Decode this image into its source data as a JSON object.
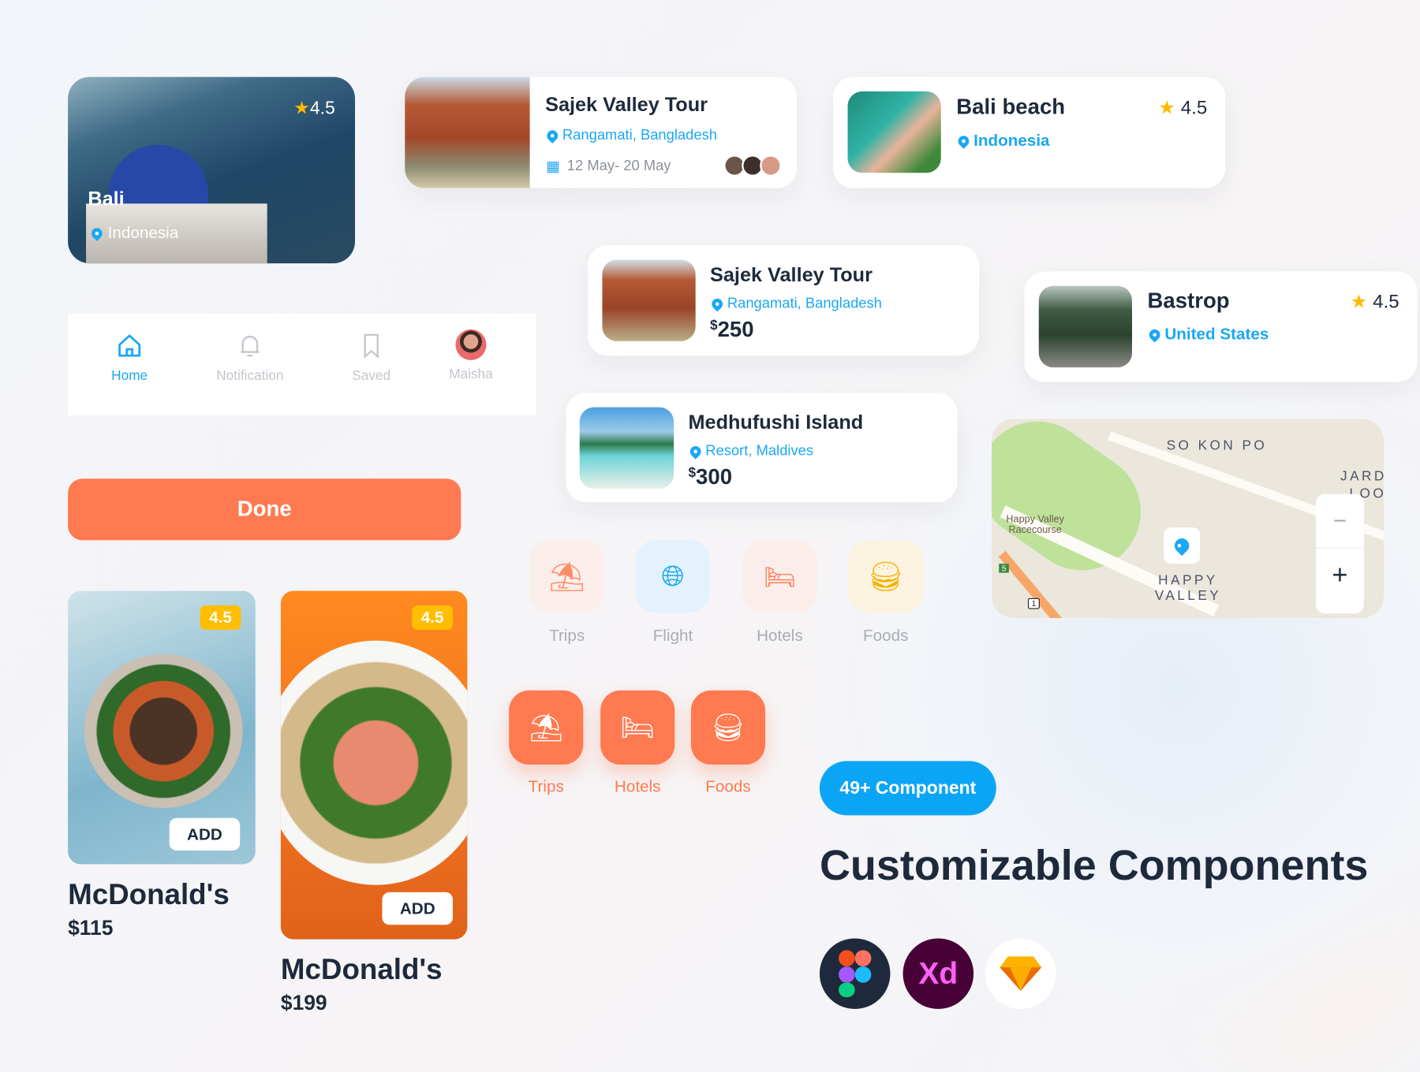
{
  "colors": {
    "accent_orange": "#FF7A50",
    "accent_blue": "#1AA7F4",
    "star": "#FFB800",
    "badge": "#FFBE00",
    "text": "#1E2A3B"
  },
  "bali_card": {
    "title": "Bali",
    "location": "Indonesia",
    "rating": "4.5"
  },
  "sajek_tour": {
    "title": "Sajek Valley Tour",
    "location": "Rangamati, Bangladesh",
    "dates": "12 May- 20 May"
  },
  "bali_beach": {
    "title": "Bali beach",
    "location": "Indonesia",
    "rating": "4.5"
  },
  "nav": {
    "items": [
      {
        "label": "Home",
        "icon": "home-icon",
        "active": true
      },
      {
        "label": "Notification",
        "icon": "bell-icon"
      },
      {
        "label": "Saved",
        "icon": "bookmark-icon"
      },
      {
        "label": "Maisha",
        "icon": "avatar"
      }
    ]
  },
  "sajek_price": {
    "title": "Sajek Valley Tour",
    "location": "Rangamati, Bangladesh",
    "currency": "$",
    "price": "250"
  },
  "bastrop": {
    "title": "Bastrop",
    "location": "United States",
    "rating": "4.5"
  },
  "medhufushi": {
    "title": "Medhufushi Island",
    "location": "Resort, Maldives",
    "currency": "$",
    "price": "300"
  },
  "map": {
    "labels": [
      "SO KON PO",
      "JARD",
      "LOOK",
      "Happy Valley",
      "Racecourse",
      "HAPPY",
      "VALLEY",
      "5",
      "1"
    ],
    "zoom_out": "−",
    "zoom_in": "+"
  },
  "done_button": "Done",
  "categories": [
    {
      "label": "Trips",
      "icon": "beach-umbrella-icon"
    },
    {
      "label": "Flight",
      "icon": "globe-plane-icon"
    },
    {
      "label": "Hotels",
      "icon": "bed-icon"
    },
    {
      "label": "Foods",
      "icon": "burger-icon"
    }
  ],
  "categories_active": [
    {
      "label": "Trips",
      "icon": "beach-umbrella-icon"
    },
    {
      "label": "Hotels",
      "icon": "bed-icon"
    },
    {
      "label": "Foods",
      "icon": "burger-icon"
    }
  ],
  "foods": [
    {
      "name": "McDonald's",
      "price": "$115",
      "rating": "4.5",
      "add": "ADD"
    },
    {
      "name": "McDonald's",
      "price": "$199",
      "rating": "4.5",
      "add": "ADD"
    }
  ],
  "promo": {
    "badge": "49+ Component",
    "heading": "Customizable Components",
    "tools": [
      "Figma",
      "Xd",
      "Sketch"
    ]
  }
}
